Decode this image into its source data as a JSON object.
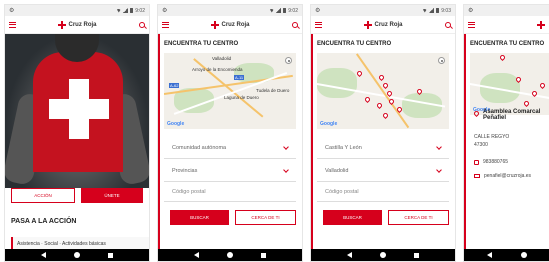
{
  "statusbar": {
    "time": "9:02",
    "time2": "9:03"
  },
  "app": {
    "logo_text": "Cruz Roja"
  },
  "screen1": {
    "btn_accion": "ACCIÓN",
    "btn_unete": "ÚNETE",
    "section_title": "PASA A LA ACCIÓN",
    "card_text": "Asistencia · Social · Actividades básicas"
  },
  "finder": {
    "title": "ENCUENTRA TU CENTRO",
    "google": "Google",
    "map_labels": [
      "Valladolid",
      "Arroyo de la Encomienda",
      "A-62",
      "A-11",
      "A-62",
      "A-11",
      "Laguna de Duero",
      "Tudela de Duero",
      "Mucientes"
    ],
    "selects_empty": [
      "Comunidad autónoma",
      "Provincias"
    ],
    "selects_filled": [
      "Castilla Y León",
      "Valladolid"
    ],
    "postal_placeholder": "Código postal",
    "buscar": "BUSCAR",
    "cerca": "CERCA DE TI"
  },
  "detail": {
    "name": "Asamblea Comarcal Peñafiel",
    "street": "CALLE REGYO",
    "zip": "47300",
    "phone": "983880765",
    "email": "penafiel@cruzroja.es"
  }
}
